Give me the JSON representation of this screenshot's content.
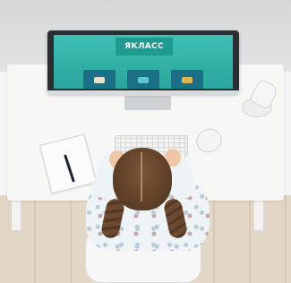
{
  "screen": {
    "banner_text": "ЯКЛАСС"
  },
  "colors": {
    "screen": "#2aa69d",
    "banner": "#1e9a8e",
    "tile": "#1b6f86",
    "hair": "#5b3c25"
  },
  "icons": {
    "monitor": "monitor-icon",
    "keyboard": "keyboard-icon",
    "mouse": "mouse-icon",
    "lamp": "lamp-icon",
    "notebook": "notebook-icon",
    "pen": "pen-icon"
  }
}
